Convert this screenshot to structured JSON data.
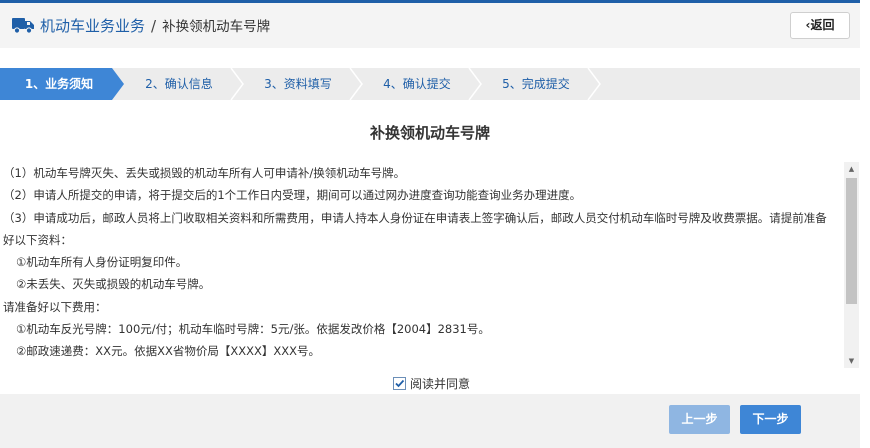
{
  "header": {
    "title": "机动车业务业务",
    "separator": "/",
    "subtitle": "补换领机动车号牌",
    "back_label": "返回",
    "back_icon": "chevron-left-icon",
    "app_icon": "truck-icon"
  },
  "steps": [
    {
      "label": "1、业务须知",
      "active": true
    },
    {
      "label": "2、确认信息",
      "active": false
    },
    {
      "label": "3、资料填写",
      "active": false
    },
    {
      "label": "4、确认提交",
      "active": false
    },
    {
      "label": "5、完成提交",
      "active": false
    }
  ],
  "notice": {
    "title": "补换领机动车号牌",
    "lines": [
      "（1）机动车号牌灭失、丢失或损毁的机动车所有人可申请补/换领机动车号牌。",
      "（2）申请人所提交的申请，将于提交后的1个工作日内受理，期间可以通过网办进度查询功能查询业务办理进度。",
      "（3）申请成功后，邮政人员将上门收取相关资料和所需费用，申请人持本人身份证在申请表上签字确认后，邮政人员交付机动车临时号牌及收费票据。请提前准备",
      "好以下资料：",
      "①机动车所有人身份证明复印件。",
      "②未丢失、灭失或损毁的机动车号牌。",
      "请准备好以下费用：",
      "①机动车反光号牌：100元/付；机动车临时号牌：5元/张。依据发改价格【2004】2831号。",
      "②邮政速递费：XX元。依据XX省物价局【XXXX】XXX号。"
    ]
  },
  "agree": {
    "label": "阅读并同意",
    "checked": true
  },
  "buttons": {
    "prev": "上一步",
    "next": "下一步"
  },
  "colors": {
    "brand": "#1f5fa8",
    "active_step": "#3e86d6",
    "button_primary": "#3e86d6",
    "button_disabled": "#8fb6e2"
  }
}
